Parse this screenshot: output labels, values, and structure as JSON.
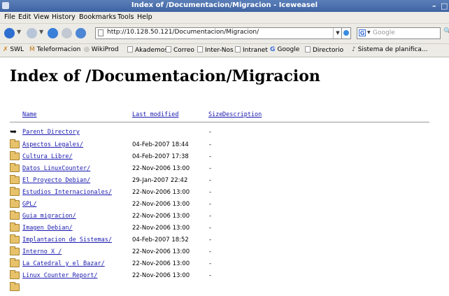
{
  "window": {
    "title": "Index of /Documentacion/Migracion - Iceweasel"
  },
  "menu": [
    "File",
    "Edit",
    "View",
    "History",
    "Bookmarks",
    "Tools",
    "Help"
  ],
  "nav": {
    "url": "http://10.128.50.121/Documentacion/Migracion/",
    "search_placeholder": "Google"
  },
  "bookmarks": [
    "SWL",
    "Teleformacion",
    "WikiProd",
    "Akademos",
    "Correo",
    "Inter-Nos",
    "Intranet",
    "Google",
    "Directorio",
    "Sistema de planifica..."
  ],
  "page": {
    "title": "Index of /Documentacion/Migracion",
    "columns": [
      "Name",
      "Last modified",
      "Size",
      "Description"
    ],
    "rows": [
      {
        "name": "Parent Directory",
        "date": "",
        "size": "-",
        "icon": "back-icon"
      },
      {
        "name": "Aspectos_Legales/",
        "date": "04-Feb-2007 18:44",
        "size": "-",
        "icon": "folder-icon"
      },
      {
        "name": "Cultura_Libre/",
        "date": "04-Feb-2007 17:38",
        "size": "-",
        "icon": "folder-icon"
      },
      {
        "name": "Datos_LinuxCounter/",
        "date": "22-Nov-2006 13:00",
        "size": "-",
        "icon": "folder-icon"
      },
      {
        "name": "El_Proyecto_Debian/",
        "date": "29-Jan-2007 22:42",
        "size": "-",
        "icon": "folder-icon"
      },
      {
        "name": "Estudios_Internacionales/",
        "date": "22-Nov-2006 13:00",
        "size": "-",
        "icon": "folder-icon"
      },
      {
        "name": "GPL/",
        "date": "22-Nov-2006 13:00",
        "size": "-",
        "icon": "folder-icon"
      },
      {
        "name": "Guia_migracion/",
        "date": "22-Nov-2006 13:00",
        "size": "-",
        "icon": "folder-icon"
      },
      {
        "name": "Imagen_Debian/",
        "date": "22-Nov-2006 13:00",
        "size": "-",
        "icon": "folder-icon"
      },
      {
        "name": "Implantacion_de_Sistemas/",
        "date": "04-Feb-2007 18:52",
        "size": "-",
        "icon": "folder-icon"
      },
      {
        "name": "Interno_X_/",
        "date": "22-Nov-2006 13:00",
        "size": "-",
        "icon": "folder-icon"
      },
      {
        "name": "La_Catedral_y_el_Bazar/",
        "date": "22-Nov-2006 13:00",
        "size": "-",
        "icon": "folder-icon"
      },
      {
        "name": "Linux_Counter_Report/",
        "date": "22-Nov-2006 13:00",
        "size": "-",
        "icon": "folder-icon"
      }
    ]
  }
}
